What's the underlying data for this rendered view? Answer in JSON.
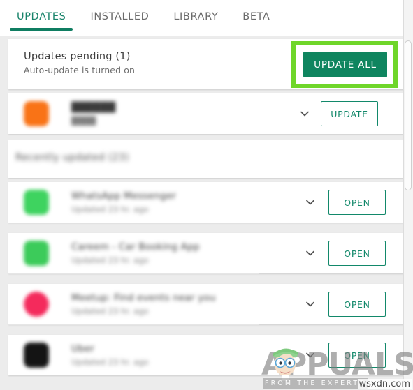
{
  "tabs": [
    {
      "label": "UPDATES",
      "active": true
    },
    {
      "label": "INSTALLED",
      "active": false
    },
    {
      "label": "LIBRARY",
      "active": false
    },
    {
      "label": "BETA",
      "active": false
    }
  ],
  "pending": {
    "title": "Updates pending (1)",
    "subtitle": "Auto-update is turned on",
    "update_all_label": "UPDATE ALL"
  },
  "pending_app": {
    "name": "██████",
    "subtitle": "████",
    "icon_color": "#F97316",
    "action_label": "UPDATE"
  },
  "section": {
    "title": "Recently updated (23)"
  },
  "recent_apps": [
    {
      "name": "WhatsApp Messenger",
      "subtitle": "Updated 23 hr. ago",
      "icon_color": "#3ED35F",
      "action_label": "OPEN"
    },
    {
      "name": "Careem - Car Booking App",
      "subtitle": "Updated 23 hr. ago",
      "icon_color": "#3CCB5A",
      "action_label": "OPEN"
    },
    {
      "name": "Meetup: Find events near you",
      "subtitle": "Updated 23 hr. ago",
      "icon_color": "#F42A5C",
      "action_label": "OPEN"
    },
    {
      "name": "Uber",
      "subtitle": "Updated 23 hr. ago",
      "icon_color": "#141414",
      "action_label": "OPEN"
    }
  ],
  "colors": {
    "accent_green": "#0f855f",
    "outline_green": "#12886a",
    "highlight_green": "#6fd62a",
    "tab_active": "#18836a",
    "page_bg": "#ececec"
  },
  "watermark": {
    "brand": "APPUALS",
    "tagline": "FROM THE EXPERTS",
    "domain": "wsxdn.com"
  }
}
